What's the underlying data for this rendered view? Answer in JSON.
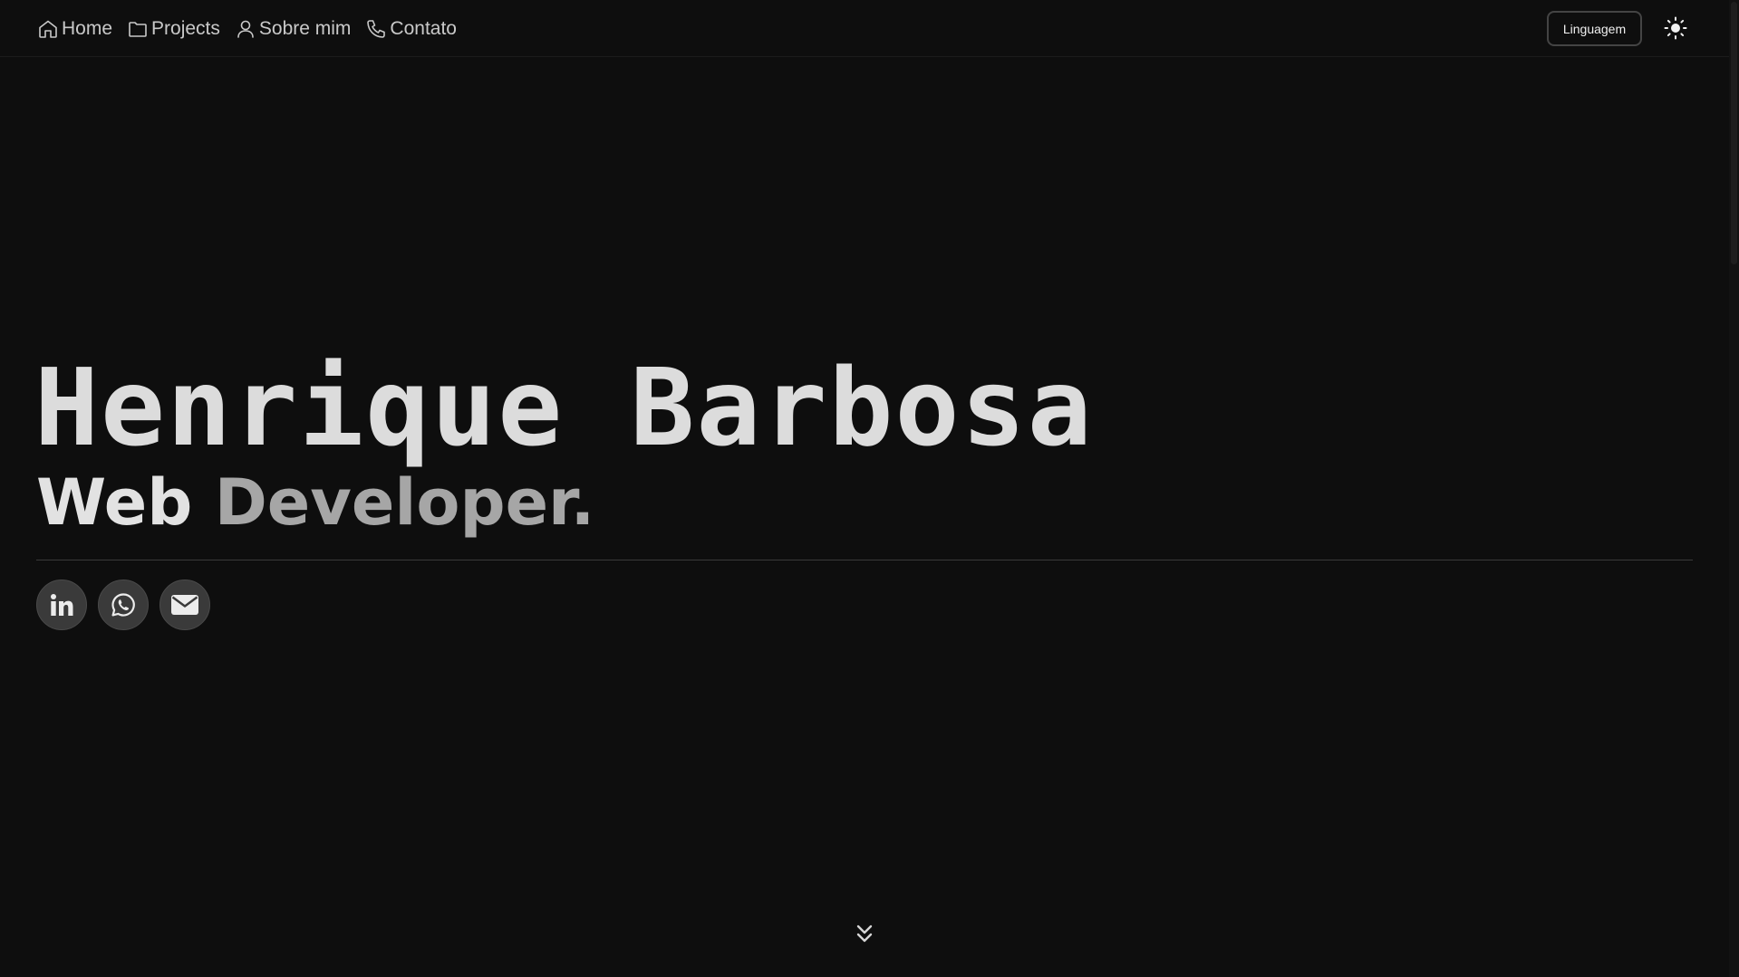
{
  "nav": {
    "links": [
      {
        "label": "Home",
        "icon": "home-icon"
      },
      {
        "label": "Projects",
        "icon": "folder-icon"
      },
      {
        "label": "Sobre mim",
        "icon": "user-icon"
      },
      {
        "label": "Contato",
        "icon": "phone-icon"
      }
    ],
    "language_button": "Linguagem",
    "theme_icon": "sun-icon"
  },
  "hero": {
    "name": "Henrique Barbosa",
    "role_first": "Web",
    "role_second": "Developer."
  },
  "socials": [
    {
      "icon": "linkedin-icon"
    },
    {
      "icon": "whatsapp-icon"
    },
    {
      "icon": "mail-icon"
    }
  ],
  "scroll_indicator": {
    "icon": "double-chevron-down-icon"
  },
  "colors": {
    "background": "#0e0e0e",
    "text_primary": "#dcdcdc",
    "text_secondary": "#a6a6a6",
    "social_bg": "#3a3a3a"
  }
}
